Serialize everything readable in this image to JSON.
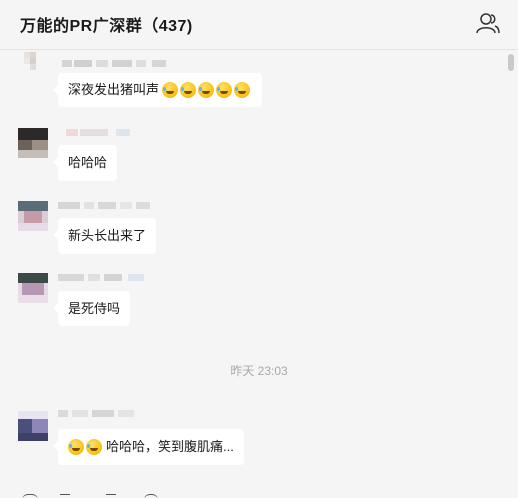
{
  "header": {
    "title": "万能的PR广深群（437)"
  },
  "messages": [
    {
      "text": "深夜发出猪叫声",
      "emoji_count": 5
    },
    {
      "text": "哈哈哈"
    },
    {
      "text": "新头长出来了"
    },
    {
      "text": "是死侍吗"
    },
    {
      "text": "哈哈哈，笑到腹肌痛...",
      "emoji_count": 2
    }
  ],
  "timestamp": "昨天 23:03",
  "icons": {
    "members": "members-icon",
    "emoji": "laughing-tears-emoji"
  },
  "colors": {
    "background": "#f5f5f5",
    "bubble": "#ffffff",
    "text": "#1a1a1a",
    "timestamp": "#a8a8a8"
  }
}
